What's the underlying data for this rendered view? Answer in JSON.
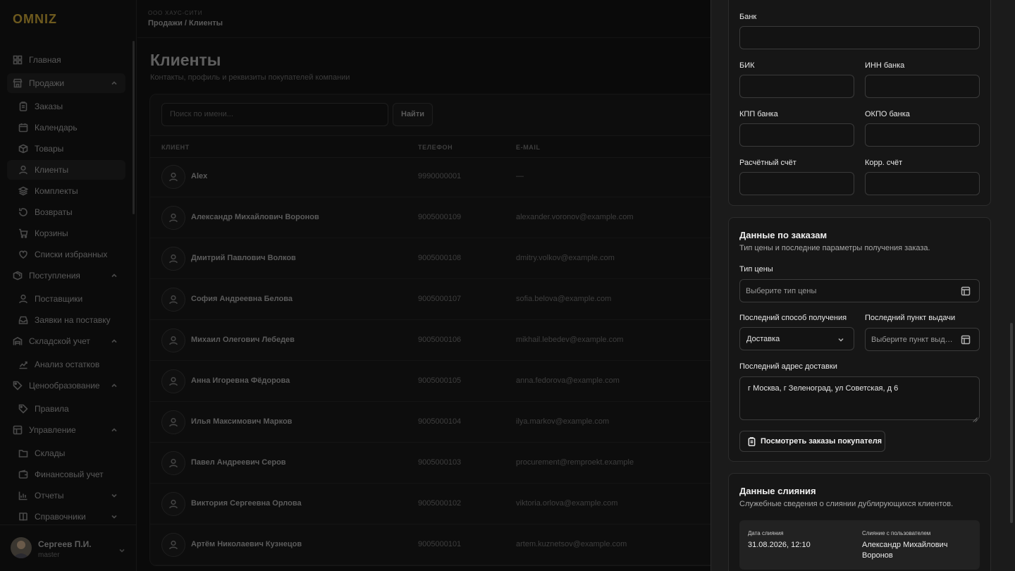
{
  "sidebar": {
    "brand": "OMNIZ",
    "items": [
      {
        "label": "Главная",
        "level": "top",
        "icon": "dashboard-icon",
        "chevron": false,
        "highlight": false
      },
      {
        "label": "Продажи",
        "level": "top",
        "icon": "store-icon",
        "chevron": true,
        "highlight": true
      },
      {
        "label": "Заказы",
        "level": "sub",
        "icon": "clipboard-icon",
        "chevron": false,
        "highlight": false
      },
      {
        "label": "Календарь",
        "level": "sub",
        "icon": "calendar-icon",
        "chevron": false,
        "highlight": false
      },
      {
        "label": "Товары",
        "level": "sub",
        "icon": "box-icon",
        "chevron": false,
        "highlight": false
      },
      {
        "label": "Клиенты",
        "level": "sub",
        "icon": "user-icon",
        "chevron": false,
        "highlight": true
      },
      {
        "label": "Комплекты",
        "level": "sub",
        "icon": "layers-icon",
        "chevron": false,
        "highlight": false
      },
      {
        "label": "Возвраты",
        "level": "sub",
        "icon": "return-icon",
        "chevron": false,
        "highlight": false
      },
      {
        "label": "Корзины",
        "level": "sub",
        "icon": "cart-icon",
        "chevron": false,
        "highlight": false
      },
      {
        "label": "Списки избранных",
        "level": "sub",
        "icon": "heart-icon",
        "chevron": false,
        "highlight": false
      },
      {
        "label": "Поступления",
        "level": "top",
        "icon": "package-icon",
        "chevron": true,
        "highlight": false
      },
      {
        "label": "Поставщики",
        "level": "sub",
        "icon": "user-icon",
        "chevron": false,
        "highlight": false
      },
      {
        "label": "Заявки на поставку",
        "level": "sub",
        "icon": "inbox-icon",
        "chevron": false,
        "highlight": false
      },
      {
        "label": "Складской учет",
        "level": "top",
        "icon": "warehouse-icon",
        "chevron": true,
        "highlight": false
      },
      {
        "label": "Анализ остатков",
        "level": "sub",
        "icon": "trend-icon",
        "chevron": false,
        "highlight": false
      },
      {
        "label": "Ценообразование",
        "level": "top",
        "icon": "price-tag-icon",
        "chevron": true,
        "highlight": false
      },
      {
        "label": "Правила",
        "level": "sub",
        "icon": "tag-icon",
        "chevron": false,
        "highlight": false
      },
      {
        "label": "Управление",
        "level": "top",
        "icon": "grid-icon",
        "chevron": true,
        "highlight": false
      },
      {
        "label": "Склады",
        "level": "sub",
        "icon": "folder-icon",
        "chevron": false,
        "highlight": false
      },
      {
        "label": "Финансовый учет",
        "level": "sub",
        "icon": "wallet-icon",
        "chevron": false,
        "highlight": false
      },
      {
        "label": "Отчеты",
        "level": "sub",
        "icon": "chart-icon",
        "chevron": true,
        "highlight": false
      },
      {
        "label": "Справочники",
        "level": "sub",
        "icon": "book-icon",
        "chevron": true,
        "highlight": false
      }
    ],
    "user": {
      "name": "Сергеев П.И.",
      "role": "master"
    }
  },
  "topbar": {
    "org": "ООО ХАУС-СИТИ",
    "breadcrumb": "Продажи / Клиенты"
  },
  "page": {
    "title": "Клиенты",
    "subtitle": "Контакты, профиль и реквизиты покупателей компании"
  },
  "search": {
    "placeholder": "Поиск по имени...",
    "button": "Найти"
  },
  "table": {
    "headers": {
      "client": "КЛИЕНТ",
      "phone": "ТЕЛЕФОН",
      "email": "E-MAIL"
    },
    "rows": [
      {
        "name": "Alex",
        "phone": "9990000001",
        "email": "—"
      },
      {
        "name": "Александр Михайлович Воронов",
        "phone": "9005000109",
        "email": "alexander.voronov@example.com"
      },
      {
        "name": "Дмитрий Павлович Волков",
        "phone": "9005000108",
        "email": "dmitry.volkov@example.com"
      },
      {
        "name": "София Андреевна Белова",
        "phone": "9005000107",
        "email": "sofia.belova@example.com"
      },
      {
        "name": "Михаил Олегович Лебедев",
        "phone": "9005000106",
        "email": "mikhail.lebedev@example.com"
      },
      {
        "name": "Анна Игоревна Фёдорова",
        "phone": "9005000105",
        "email": "anna.fedorova@example.com"
      },
      {
        "name": "Илья Максимович Марков",
        "phone": "9005000104",
        "email": "ilya.markov@example.com"
      },
      {
        "name": "Павел Андреевич Серов",
        "phone": "9005000103",
        "email": "procurement@remproekt.example"
      },
      {
        "name": "Виктория Сергеевна Орлова",
        "phone": "9005000102",
        "email": "viktoria.orlova@example.com"
      },
      {
        "name": "Артём Николаевич Кузнецов",
        "phone": "9005000101",
        "email": "artem.kuznetsov@example.com"
      }
    ]
  },
  "panel": {
    "bank": {
      "bank_label": "Банк",
      "bik_label": "БИК",
      "bank_inn_label": "ИНН банка",
      "kpp_label": "КПП банка",
      "okpo_label": "ОКПО банка",
      "account_label": "Расчётный счёт",
      "corr_label": "Корр. счёт"
    },
    "orders": {
      "title": "Данные по заказам",
      "desc": "Тип цены и последние параметры получения заказа.",
      "price_type_label": "Тип цены",
      "price_type_placeholder": "Выберите тип цены",
      "delivery_method_label": "Последний способ получения",
      "delivery_method_value": "Доставка",
      "pickup_point_label": "Последний пункт выдачи",
      "pickup_point_placeholder": "Выберите пункт выдачи",
      "address_label": "Последний адрес доставки",
      "address_value": "г Москва, г Зеленоград, ул Советская, д 6",
      "view_orders_button": "Посмотреть заказы покупателя"
    },
    "merge": {
      "title": "Данные слияния",
      "desc": "Служебные сведения о слиянии дублирующихся клиентов.",
      "date_label": "Дата слияния",
      "date_value": "31.08.2026, 12:10",
      "user_label": "Слияние с пользователем",
      "user_value": "Александр Михайлович Воронов"
    }
  }
}
